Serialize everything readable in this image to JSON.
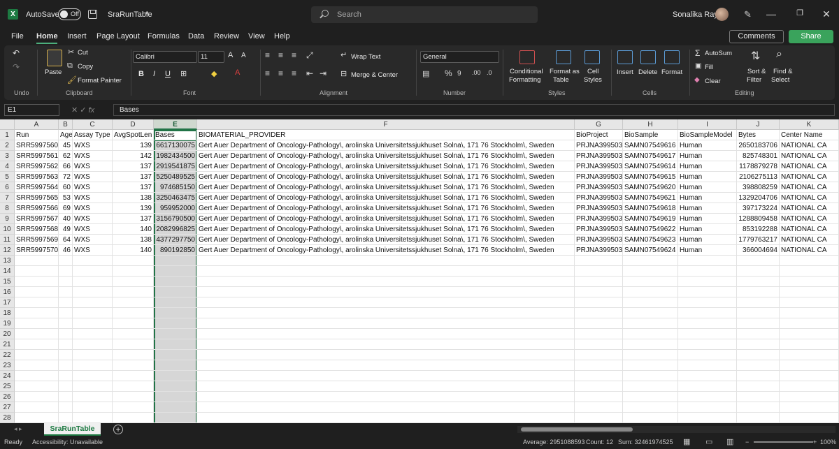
{
  "title_bar": {
    "autosave_label": "AutoSave",
    "autosave_state": "Off",
    "document_name": "SraRunTable",
    "search_placeholder": "Search",
    "user_name": "Sonalika Ray",
    "share_top": "Share"
  },
  "menu": {
    "tabs": [
      "File",
      "Home",
      "Insert",
      "Page Layout",
      "Formulas",
      "Data",
      "Review",
      "View",
      "Help"
    ],
    "active": "Home",
    "comments_label": "Comments",
    "share_label": "Share"
  },
  "ribbon": {
    "undo_label": "Undo",
    "clipboard": {
      "paste": "Paste",
      "cut": "Cut",
      "copy": "Copy",
      "format_painter": "Format Painter",
      "label": "Clipboard"
    },
    "font": {
      "name": "Calibri",
      "size": "11",
      "bold": "B",
      "italic": "I",
      "underline": "U",
      "label": "Font"
    },
    "alignment": {
      "wrap_text": "Wrap Text",
      "merge_center": "Merge & Center",
      "label": "Alignment"
    },
    "number": {
      "format": "General",
      "label": "Number"
    },
    "styles": {
      "conditional": "Conditional",
      "conditional2": "Formatting",
      "format_as": "Format as",
      "format_as2": "Table",
      "cell": "Cell",
      "cell2": "Styles",
      "label": "Styles"
    },
    "cells": {
      "insert": "Insert",
      "delete": "Delete",
      "format": "Format",
      "label": "Cells"
    },
    "editing": {
      "autosum": "AutoSum",
      "fill": "Fill",
      "clear": "Clear",
      "sort": "Sort &",
      "sort2": "Filter",
      "find": "Find &",
      "find2": "Select",
      "label": "Editing"
    }
  },
  "formula_bar": {
    "name_box": "E1",
    "content": "Bases"
  },
  "sheet": {
    "columns": [
      "A",
      "B",
      "C",
      "D",
      "E",
      "F",
      "G",
      "H",
      "I",
      "J",
      "K"
    ],
    "selected_column": "E",
    "header_row": [
      "Run",
      "Age",
      "Assay Type",
      "AvgSpotLen",
      "Bases",
      "BIOMATERIAL_PROVIDER",
      "BioProject",
      "BioSample",
      "BioSampleModel",
      "Bytes",
      "Center Name"
    ],
    "rows": [
      [
        "SRR5997560",
        "45",
        "WXS",
        "139",
        "6617130075",
        "Gert Auer Department of Oncology-Pathology\\, arolinska Universitetssjukhuset Solna\\, 171 76 Stockholm\\, Sweden",
        "PRJNA399503",
        "SAMN07549616",
        "Human",
        "2650183706",
        "NATIONAL CA"
      ],
      [
        "SRR5997561",
        "62",
        "WXS",
        "142",
        "1982434500",
        "Gert Auer Department of Oncology-Pathology\\, arolinska Universitetssjukhuset Solna\\, 171 76 Stockholm\\, Sweden",
        "PRJNA399503",
        "SAMN07549617",
        "Human",
        "825748301",
        "NATIONAL CA"
      ],
      [
        "SRR5997562",
        "66",
        "WXS",
        "137",
        "2919541875",
        "Gert Auer Department of Oncology-Pathology\\, arolinska Universitetssjukhuset Solna\\, 171 76 Stockholm\\, Sweden",
        "PRJNA399503",
        "SAMN07549614",
        "Human",
        "1178879278",
        "NATIONAL CA"
      ],
      [
        "SRR5997563",
        "72",
        "WXS",
        "137",
        "5250489525",
        "Gert Auer Department of Oncology-Pathology\\, arolinska Universitetssjukhuset Solna\\, 171 76 Stockholm\\, Sweden",
        "PRJNA399503",
        "SAMN07549615",
        "Human",
        "2106275113",
        "NATIONAL CA"
      ],
      [
        "SRR5997564",
        "60",
        "WXS",
        "137",
        "974685150",
        "Gert Auer Department of Oncology-Pathology\\, arolinska Universitetssjukhuset Solna\\, 171 76 Stockholm\\, Sweden",
        "PRJNA399503",
        "SAMN07549620",
        "Human",
        "398808259",
        "NATIONAL CA"
      ],
      [
        "SRR5997565",
        "53",
        "WXS",
        "138",
        "3250463475",
        "Gert Auer Department of Oncology-Pathology\\, arolinska Universitetssjukhuset Solna\\, 171 76 Stockholm\\, Sweden",
        "PRJNA399503",
        "SAMN07549621",
        "Human",
        "1329204706",
        "NATIONAL CA"
      ],
      [
        "SRR5997566",
        "69",
        "WXS",
        "139",
        "959952000",
        "Gert Auer Department of Oncology-Pathology\\, arolinska Universitetssjukhuset Solna\\, 171 76 Stockholm\\, Sweden",
        "PRJNA399503",
        "SAMN07549618",
        "Human",
        "397173224",
        "NATIONAL CA"
      ],
      [
        "SRR5997567",
        "40",
        "WXS",
        "137",
        "3156790500",
        "Gert Auer Department of Oncology-Pathology\\, arolinska Universitetssjukhuset Solna\\, 171 76 Stockholm\\, Sweden",
        "PRJNA399503",
        "SAMN07549619",
        "Human",
        "1288809458",
        "NATIONAL CA"
      ],
      [
        "SRR5997568",
        "49",
        "WXS",
        "140",
        "2082996825",
        "Gert Auer Department of Oncology-Pathology\\, arolinska Universitetssjukhuset Solna\\, 171 76 Stockholm\\, Sweden",
        "PRJNA399503",
        "SAMN07549622",
        "Human",
        "853192288",
        "NATIONAL CA"
      ],
      [
        "SRR5997569",
        "64",
        "WXS",
        "138",
        "4377297750",
        "Gert Auer Department of Oncology-Pathology\\, arolinska Universitetssjukhuset Solna\\, 171 76 Stockholm\\, Sweden",
        "PRJNA399503",
        "SAMN07549623",
        "Human",
        "1779763217",
        "NATIONAL CA"
      ],
      [
        "SRR5997570",
        "46",
        "WXS",
        "140",
        "890192850",
        "Gert Auer Department of Oncology-Pathology\\, arolinska Universitetssjukhuset Solna\\, 171 76 Stockholm\\, Sweden",
        "PRJNA399503",
        "SAMN07549624",
        "Human",
        "366004694",
        "NATIONAL CA"
      ]
    ],
    "row_count_visible": 28,
    "sheet_tab": "SraRunTable"
  },
  "status_bar": {
    "ready": "Ready",
    "accessibility": "Accessibility: Unavailable",
    "average": "Average: 2951088593",
    "count": "Count: 12",
    "sum": "Sum: 32461974525",
    "zoom": "100%"
  },
  "colors": {
    "accent_green": "#217346",
    "share_green": "#3aa35c"
  }
}
